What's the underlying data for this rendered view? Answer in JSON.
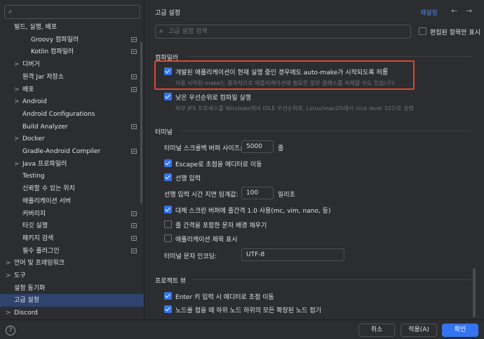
{
  "sidebar": {
    "search_placeholder": "",
    "items": [
      {
        "label": "빌드, 실행, 배포",
        "arrow": "",
        "indent": 0,
        "mark": false,
        "selected": false
      },
      {
        "label": "Groovy 컴파일러",
        "arrow": "",
        "indent": 2,
        "mark": true,
        "selected": false
      },
      {
        "label": "Kotlin 컴파일러",
        "arrow": "",
        "indent": 2,
        "mark": true,
        "selected": false
      },
      {
        "label": "디버거",
        "arrow": ">",
        "indent": 1,
        "mark": false,
        "selected": false
      },
      {
        "label": "원격 Jar 저장소",
        "arrow": "",
        "indent": 1,
        "mark": true,
        "selected": false
      },
      {
        "label": "배포",
        "arrow": ">",
        "indent": 1,
        "mark": true,
        "selected": false
      },
      {
        "label": "Android",
        "arrow": ">",
        "indent": 1,
        "mark": false,
        "selected": false
      },
      {
        "label": "Android Configurations",
        "arrow": "",
        "indent": 1,
        "mark": false,
        "selected": false
      },
      {
        "label": "Build Analyzer",
        "arrow": "",
        "indent": 1,
        "mark": true,
        "selected": false
      },
      {
        "label": "Docker",
        "arrow": ">",
        "indent": 1,
        "mark": false,
        "selected": false
      },
      {
        "label": "Gradle-Android Compiler",
        "arrow": "",
        "indent": 1,
        "mark": true,
        "selected": false
      },
      {
        "label": "Java 프로파일러",
        "arrow": ">",
        "indent": 1,
        "mark": false,
        "selected": false
      },
      {
        "label": "Testing",
        "arrow": "",
        "indent": 1,
        "mark": false,
        "selected": false
      },
      {
        "label": "신뢰할 수 있는 위치",
        "arrow": "",
        "indent": 1,
        "mark": false,
        "selected": false
      },
      {
        "label": "애플리케이션 서버",
        "arrow": "",
        "indent": 1,
        "mark": false,
        "selected": false
      },
      {
        "label": "커버리지",
        "arrow": "",
        "indent": 1,
        "mark": true,
        "selected": false
      },
      {
        "label": "타깃 실행",
        "arrow": "",
        "indent": 1,
        "mark": true,
        "selected": false
      },
      {
        "label": "패키지 검색",
        "arrow": "",
        "indent": 1,
        "mark": true,
        "selected": false
      },
      {
        "label": "필수 플러그인",
        "arrow": "",
        "indent": 1,
        "mark": true,
        "selected": false
      },
      {
        "label": "언어 및 프레임워크",
        "arrow": ">",
        "indent": 0,
        "mark": false,
        "selected": false
      },
      {
        "label": "도구",
        "arrow": ">",
        "indent": 0,
        "mark": false,
        "selected": false
      },
      {
        "label": "설정 동기화",
        "arrow": "",
        "indent": 0,
        "mark": false,
        "selected": false
      },
      {
        "label": "고급 설정",
        "arrow": "",
        "indent": 0,
        "mark": false,
        "selected": true
      },
      {
        "label": "Discord",
        "arrow": ">",
        "indent": 0,
        "mark": false,
        "selected": false
      }
    ]
  },
  "main": {
    "title": "고급 설정",
    "reset_label": "재설정",
    "back_icon": "←",
    "forward_icon": "→",
    "search_placeholder": "고급 설정 검색",
    "edited_only_label": "편집된 항목만 표시",
    "compiler": {
      "header": "컴파일러",
      "auto_make_label": "개발된 애플리케이션이 현재 실행 중인 경우에도 auto-make가 시작되도록 허용",
      "auto_make_desc": "자동 시작된 make는 결과적으로 애플리케이션에 필요한 일부 클래스를 삭제할 수도 있습니다",
      "low_priority_label": "낮은 우선순위로 컴파일 실행",
      "low_priority_desc": "외부 JPS 프로세스를 Windows에서 IDLE 우선순위로, Linux/macOS에서 nice level 10으로 실행"
    },
    "terminal": {
      "header": "터미널",
      "scroll_buffer_label": "터미널 스크롤백 버퍼 사이즈:",
      "scroll_buffer_value": "5000",
      "scroll_buffer_unit": "줄",
      "escape_label": "Escape로 초점을 에디터로 이동",
      "type_ahead_label": "선행 입력",
      "type_ahead_latency_label": "선행 입력 시간 지연 임계값:",
      "type_ahead_latency_value": "100",
      "type_ahead_latency_unit": "밀리초",
      "alt_buffer_label": "대체 스크린 버퍼에 줄간격 1.0 사용(mc, vim, nano, 등)",
      "line_spacing_label": "줄 간격을 포함한 문자 배경 채우기",
      "app_title_label": "애플리케이션 제목 표시",
      "encoding_label": "터미널 문자 인코딩:",
      "encoding_value": "UTF-8"
    },
    "project_view": {
      "header": "프로젝트 뷰",
      "enter_focus_label": "Enter 키 입력 시 에디터로 초점 이동",
      "collapse_label": "노드를 접을 때 하위 노드 하위의 모든 확장된 노드 접기"
    }
  },
  "footer": {
    "help_label": "?",
    "cancel_label": "취소",
    "apply_label": "적용(A)",
    "ok_label": "확인"
  },
  "colors": {
    "accent": "#3574f0",
    "highlight": "#e0462f",
    "selection": "#2e436e"
  }
}
